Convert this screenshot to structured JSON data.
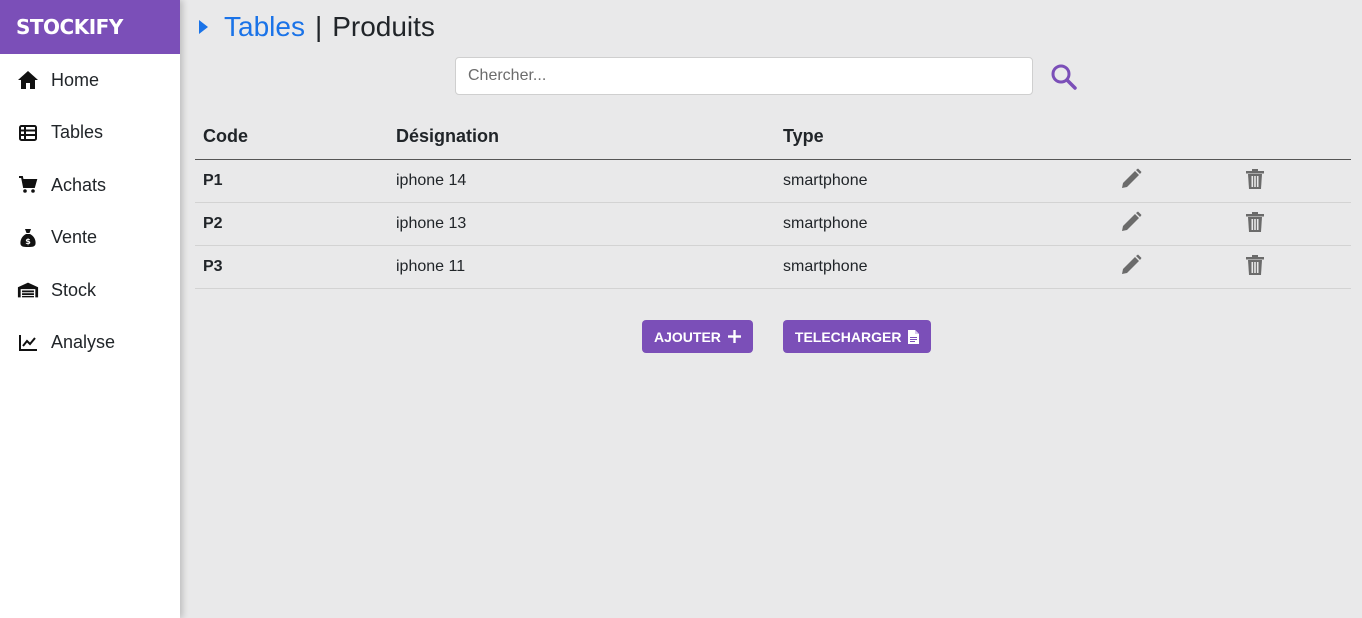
{
  "brand": {
    "name": "STOCKIFY",
    "color": "#7b4fb8"
  },
  "sidebar": {
    "items": [
      {
        "label": "Home",
        "icon": "home-icon"
      },
      {
        "label": "Tables",
        "icon": "table-icon"
      },
      {
        "label": "Achats",
        "icon": "cart-icon"
      },
      {
        "label": "Vente",
        "icon": "money-bag-icon"
      },
      {
        "label": "Stock",
        "icon": "warehouse-icon"
      },
      {
        "label": "Analyse",
        "icon": "chart-line-icon"
      }
    ]
  },
  "breadcrumb": {
    "parent": "Tables",
    "separator": "|",
    "current": "Produits",
    "link_color": "#1a73e8"
  },
  "search": {
    "placeholder": "Chercher...",
    "value": ""
  },
  "table": {
    "headers": {
      "code": "Code",
      "designation": "Désignation",
      "type": "Type"
    },
    "rows": [
      {
        "code": "P1",
        "designation": "iphone 14",
        "type": "smartphone"
      },
      {
        "code": "P2",
        "designation": "iphone 13",
        "type": "smartphone"
      },
      {
        "code": "P3",
        "designation": "iphone 11",
        "type": "smartphone"
      }
    ]
  },
  "actions": {
    "add_label": "AJOUTER",
    "download_label": "TELECHARGER"
  }
}
